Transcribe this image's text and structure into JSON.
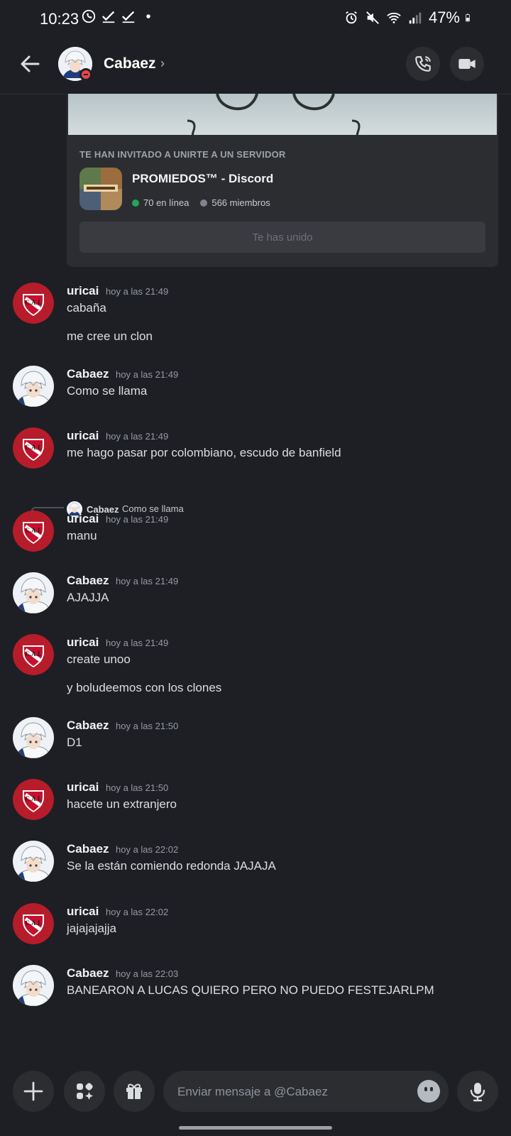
{
  "status_bar": {
    "time": "10:23",
    "battery": "47%"
  },
  "header": {
    "name": "Cabaez",
    "chevron": "›"
  },
  "invite": {
    "label": "TE HAN INVITADO A UNIRTE A UN SERVIDOR",
    "server_name": "PROMIEDOS™ - Discord",
    "online": "70 en línea",
    "members": "566 miembros",
    "button": "Te has unido",
    "online_color": "#23a55a",
    "offline_color": "#80848e"
  },
  "reply_ref": {
    "author": "Cabaez",
    "text": "Como se llama"
  },
  "messages": [
    {
      "author": "uricai",
      "time": "hoy a las 21:49",
      "lines": [
        "cabaña",
        "me cree un clon"
      ]
    },
    {
      "author": "Cabaez",
      "time": "hoy a las 21:49",
      "lines": [
        "Como se llama"
      ]
    },
    {
      "author": "uricai",
      "time": "hoy a las 21:49",
      "lines": [
        "me hago pasar por colombiano, escudo de banfield"
      ]
    },
    {
      "author": "uricai",
      "time": "hoy a las 21:49",
      "lines": [
        "manu"
      ]
    },
    {
      "author": "Cabaez",
      "time": "hoy a las 21:49",
      "lines": [
        "AJAJJA"
      ]
    },
    {
      "author": "uricai",
      "time": "hoy a las 21:49",
      "lines": [
        "create unoo",
        "y boludeemos con los clones"
      ]
    },
    {
      "author": "Cabaez",
      "time": "hoy a las 21:50",
      "lines": [
        "D1"
      ]
    },
    {
      "author": "uricai",
      "time": "hoy a las 21:50",
      "lines": [
        "hacete un extranjero"
      ]
    },
    {
      "author": "Cabaez",
      "time": "hoy a las 22:02",
      "lines": [
        "Se la están comiendo redonda JAJAJA"
      ]
    },
    {
      "author": "uricai",
      "time": "hoy a las 22:02",
      "lines": [
        "jajajajajja"
      ]
    },
    {
      "author": "Cabaez",
      "time": "hoy a las 22:03",
      "lines": [
        "BANEARON A LUCAS QUIERO PERO NO PUEDO FESTEJARLPM"
      ]
    }
  ],
  "composer": {
    "placeholder": "Enviar mensaje a @Cabaez"
  },
  "colors": {
    "background": "#1e1f24",
    "card": "#2b2d31",
    "club_red": "#b71c2b"
  },
  "icons": [
    "whatsapp-icon",
    "check-icon",
    "alarm-icon",
    "mute-icon",
    "wifi-icon",
    "signal-icon",
    "battery-icon",
    "back-arrow-icon",
    "call-icon",
    "video-icon",
    "plus-icon",
    "apps-icon",
    "gift-icon",
    "emoji-icon",
    "mic-icon"
  ]
}
